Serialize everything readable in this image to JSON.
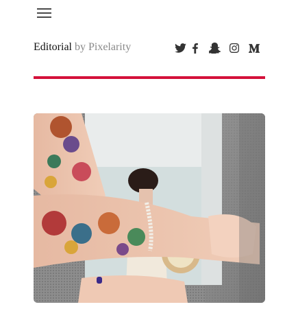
{
  "header": {
    "menu_icon": "hamburger-menu-icon",
    "brand_name": "Editorial",
    "brand_by": "by Pixelarity"
  },
  "social": [
    {
      "name": "twitter",
      "icon": "twitter-icon"
    },
    {
      "name": "facebook",
      "icon": "facebook-icon"
    },
    {
      "name": "snapchat",
      "icon": "snapchat-icon"
    },
    {
      "name": "instagram",
      "icon": "instagram-icon"
    },
    {
      "name": "medium",
      "icon": "medium-icon"
    }
  ],
  "colors": {
    "accent": "#d4113a",
    "text": "#111111",
    "muted": "#888888",
    "icon": "#333333"
  },
  "hero": {
    "subject": "tattooed-arms-holding-magazine-image"
  }
}
